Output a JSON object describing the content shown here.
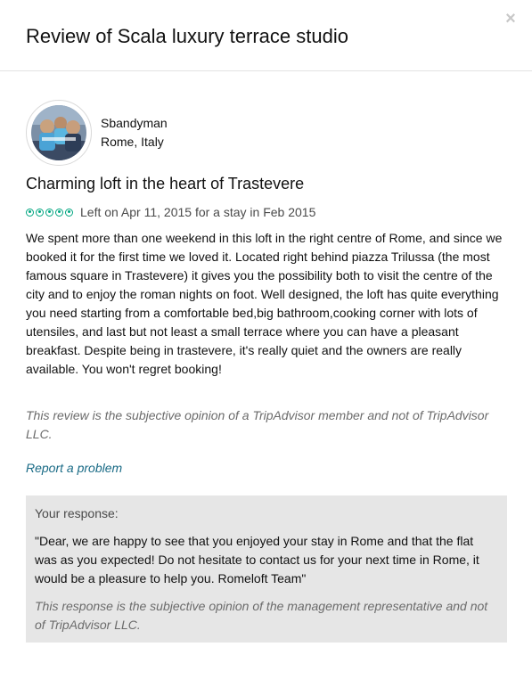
{
  "modal": {
    "title": "Review of Scala luxury terrace studio",
    "close_symbol": "×",
    "close_icon": "close-icon"
  },
  "reviewer": {
    "name": "Sbandyman",
    "location": "Rome, Italy"
  },
  "review": {
    "title": "Charming loft in the heart of Trastevere",
    "rating": 5,
    "rating_max": 5,
    "rating_color": "#00a680",
    "meta": "Left on Apr 11, 2015 for a stay in Feb 2015",
    "body": "We spent more than one weekend in this loft in the right centre of Rome, and since we booked it for the first time we loved it. Located right behind piazza Trilussa (the most famous square in Trastevere) it gives you the possibility both to visit the centre of the city and to enjoy the roman nights on foot. Well designed, the loft has quite everything you need starting from a comfortable bed,big bathroom,cooking corner with lots of utensiles, and last but not least a small terrace where you can have a pleasant breakfast. Despite being in trastevere, it's really quiet and the owners are really available. You won't regret booking!",
    "disclaimer": "This review is the subjective opinion of a TripAdvisor member and not of TripAdvisor LLC.",
    "report_link": "Report a problem"
  },
  "response": {
    "label": "Your response:",
    "text": "\"Dear, we are happy to see that you enjoyed your stay in Rome and that the flat was as you expected! Do not hesitate to contact us for your next time in Rome, it would be a pleasure to help you. Romeloft Team\"",
    "disclaimer": "This response is the subjective opinion of the management representative and not of TripAdvisor LLC."
  },
  "colors": {
    "link": "#1a6b86",
    "response_background": "#e6e6e6",
    "muted_text": "#6b6b6b"
  }
}
